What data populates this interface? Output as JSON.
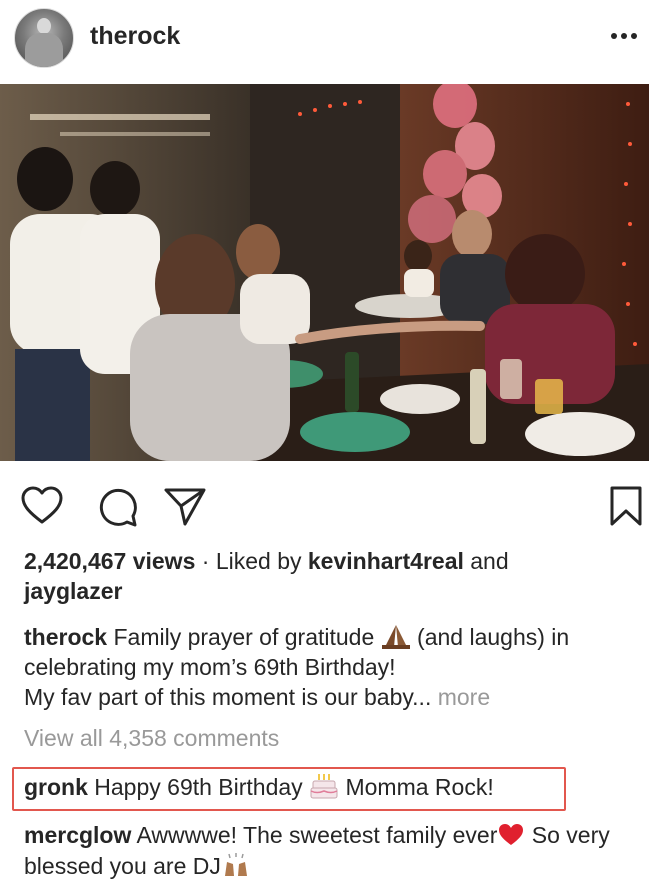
{
  "header": {
    "username": "therock",
    "avatar_icon": "profile-avatar",
    "more_icon": "more-horizontal-icon"
  },
  "photo": {
    "description_icon": "post-photo"
  },
  "actions": {
    "like_icon": "heart-icon",
    "comment_icon": "comment-icon",
    "share_icon": "send-icon",
    "save_icon": "bookmark-icon"
  },
  "stats": {
    "views": "2,420,467 views",
    "separator": " · ",
    "liked_by_prefix": "Liked by ",
    "liked_by_user": "kevinhart4real",
    "and": " and",
    "other_user": "jayglazer"
  },
  "caption": {
    "author": "therock",
    "text_before_emoji": " Family prayer of gratitude ",
    "text_after_emoji": " (and laughs) in celebrating my mom’s 69th Birthday!",
    "line2": "My fav part of this moment is our baby...",
    "more_label": " more"
  },
  "comments_link": "View all 4,358 comments",
  "comments": [
    {
      "author": "gronk",
      "text_before_emoji": " Happy 69th Birthday ",
      "text_after_emoji": " Momma Rock!"
    },
    {
      "author": "mercglow",
      "text_before_emoji": " Awwwwe! The sweetest family ever",
      "text_after_emoji": " So very blessed you are DJ"
    }
  ],
  "colors": {
    "highlight_border": "#e2574e",
    "muted_text": "#999999",
    "primary_text": "#262626"
  }
}
